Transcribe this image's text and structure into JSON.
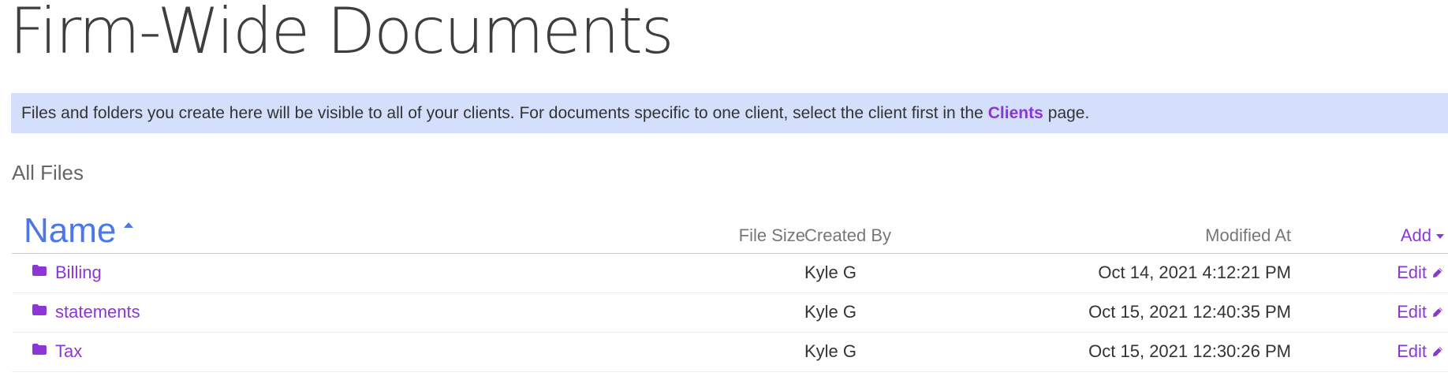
{
  "page": {
    "title": "Firm-Wide Documents"
  },
  "banner": {
    "text_before": "Files and folders you create here will be visible to all of your clients. For documents specific to one client, select the client first in the",
    "link_label": "Clients",
    "text_after": "page.",
    "color": "#d4dffb"
  },
  "section": {
    "title": "All Files"
  },
  "table": {
    "columns": {
      "name": "Name",
      "file_size": "File Size",
      "created_by": "Created By",
      "modified_at": "Modified At",
      "add": "Add"
    },
    "sort": {
      "column": "Name",
      "direction": "ascending"
    },
    "rows": [
      {
        "icon": "folder-icon",
        "name": "Billing",
        "file_size": "",
        "created_by": "Kyle G",
        "modified_at": "Oct 14, 2021 4:12:21 PM",
        "action": "Edit"
      },
      {
        "icon": "folder-icon",
        "name": "statements",
        "file_size": "",
        "created_by": "Kyle G",
        "modified_at": "Oct 15, 2021 12:40:35 PM",
        "action": "Edit"
      },
      {
        "icon": "folder-icon",
        "name": "Tax",
        "file_size": "",
        "created_by": "Kyle G",
        "modified_at": "Oct 15, 2021 12:30:26 PM",
        "action": "Edit"
      }
    ]
  },
  "colors": {
    "accent": "#8d36d6",
    "header_link": "#4a78e6",
    "title_text": "#3e3e3e"
  }
}
